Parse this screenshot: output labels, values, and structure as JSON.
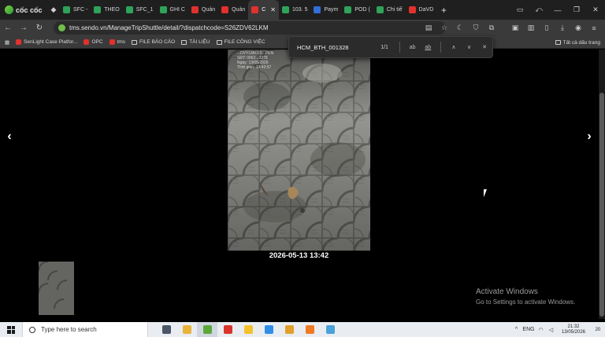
{
  "browser": {
    "brand": "cốc cốc",
    "tabs": [
      {
        "title": "SFC -",
        "color": "#2fa35a"
      },
      {
        "title": "THEO",
        "color": "#2fa35a"
      },
      {
        "title": "SFC_1",
        "color": "#2fa35a"
      },
      {
        "title": "GHI C",
        "color": "#2fa35a"
      },
      {
        "title": "Quản",
        "color": "#e2312d"
      },
      {
        "title": "Quản",
        "color": "#e2312d"
      },
      {
        "title": "C",
        "color": "#e2312d",
        "active": true
      },
      {
        "title": "103. 5",
        "color": "#2fa35a"
      },
      {
        "title": "Paym",
        "color": "#2f6fd6"
      },
      {
        "title": "POD (",
        "color": "#2fa35a"
      },
      {
        "title": "Chi tiế",
        "color": "#2fa35a"
      },
      {
        "title": "DaVD",
        "color": "#e2312d"
      }
    ],
    "address": "tms.sendo.vn/ManageTripShuttle/detail/?dispatchcode=S26ZDV62LKM",
    "bookmarks": [
      {
        "label": "SenLight Case Platfor...",
        "type": "fav",
        "color": "#e2312d"
      },
      {
        "label": "OPC",
        "type": "fav",
        "color": "#e2312d"
      },
      {
        "label": "tms",
        "type": "fav",
        "color": "#e2312d"
      },
      {
        "label": "FILE BÁO CÁO",
        "type": "folder"
      },
      {
        "label": "TÀI LIỆU",
        "type": "folder"
      },
      {
        "label": "FILE CÔNG VIỆC",
        "type": "folder"
      }
    ],
    "all_bookmarks": "Tất cả dấu trang"
  },
  "find": {
    "query": "HCM_BTH_001328",
    "count": "1/1",
    "opt_case": "ab",
    "opt_word": "ab"
  },
  "viewer": {
    "caption": "2026-05-13 13:42",
    "photo_overlay": [
      "...DVYLMKUS...PEN",
      "SĐT: 0962...3278",
      "Ngày: 13/05/2026",
      "Thời gian: 13:42:57"
    ]
  },
  "watermark": {
    "line1": "Activate Windows",
    "line2": "Go to Settings to activate Windows."
  },
  "taskbar": {
    "search_placeholder": "Type here to search",
    "apps": [
      {
        "name": "task-view",
        "color": "#4a5565"
      },
      {
        "name": "file-explorer",
        "color": "#e9b23a"
      },
      {
        "name": "coccoc",
        "color": "#5aa83a",
        "active": true
      },
      {
        "name": "wps-office",
        "color": "#d9342b"
      },
      {
        "name": "sticky-notes",
        "color": "#f3c12d"
      },
      {
        "name": "zalo",
        "color": "#2f8fe8"
      },
      {
        "name": "chrome",
        "color": "#e0a02a"
      },
      {
        "name": "firefox",
        "color": "#f07a22"
      },
      {
        "name": "notepad",
        "color": "#4aa0d8"
      }
    ],
    "language": "ENG",
    "time": "21:32",
    "date": "13/05/2026",
    "notifications": "20"
  }
}
